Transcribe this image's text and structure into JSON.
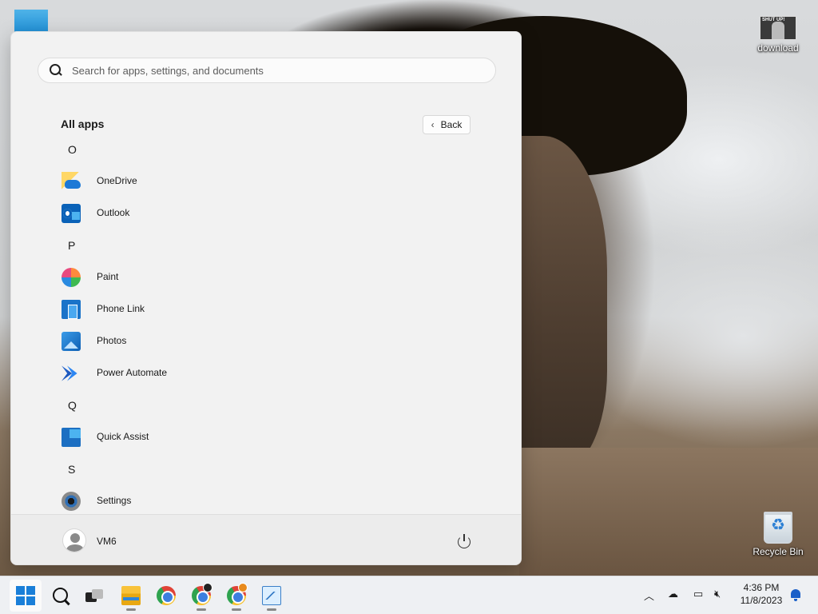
{
  "desktop": {
    "icons": [
      {
        "label": "download",
        "icon": "image-file-icon",
        "thumb_text": "SHUT UP!"
      },
      {
        "label": "Recycle Bin",
        "icon": "recycle-bin-icon"
      }
    ]
  },
  "start_menu": {
    "search": {
      "placeholder": "Search for apps, settings, and documents",
      "value": ""
    },
    "section_title": "All apps",
    "back_label": "Back",
    "apps": [
      {
        "type": "letter",
        "text": "O"
      },
      {
        "type": "app",
        "name": "OneDrive",
        "icon": "onedrive-icon"
      },
      {
        "type": "app",
        "name": "Outlook",
        "icon": "outlook-icon"
      },
      {
        "type": "letter",
        "text": "P"
      },
      {
        "type": "app",
        "name": "Paint",
        "icon": "paint-icon"
      },
      {
        "type": "app",
        "name": "Phone Link",
        "icon": "phone-link-icon"
      },
      {
        "type": "app",
        "name": "Photos",
        "icon": "photos-icon"
      },
      {
        "type": "app",
        "name": "Power Automate",
        "icon": "power-automate-icon"
      },
      {
        "type": "letter",
        "text": "Q"
      },
      {
        "type": "app",
        "name": "Quick Assist",
        "icon": "quick-assist-icon"
      },
      {
        "type": "letter",
        "text": "S"
      },
      {
        "type": "app",
        "name": "Settings",
        "icon": "settings-gear-icon"
      }
    ],
    "user": {
      "name": "VM6"
    },
    "power_icon": "power-icon"
  },
  "taskbar": {
    "items": [
      {
        "name": "start",
        "icon": "windows-logo-icon",
        "active": true
      },
      {
        "name": "search",
        "icon": "search-icon"
      },
      {
        "name": "task-view",
        "icon": "task-view-icon"
      },
      {
        "name": "file-explorer",
        "icon": "folder-icon",
        "running": true
      },
      {
        "name": "chrome",
        "icon": "chrome-icon"
      },
      {
        "name": "chrome-profile-1",
        "icon": "chrome-icon",
        "running": true
      },
      {
        "name": "chrome-profile-2",
        "icon": "chrome-icon",
        "running": true
      },
      {
        "name": "resource-monitor",
        "icon": "monitor-chart-icon",
        "running": true
      }
    ],
    "tray": {
      "icons": [
        "chevron-up-icon",
        "cloud-offline-icon",
        "network-icon",
        "volume-muted-icon"
      ],
      "time": "4:36 PM",
      "date": "11/8/2023",
      "notification_icon": "bell-icon"
    }
  },
  "colors": {
    "accent": "#1a7fd8",
    "menu_bg": "#f2f2f2",
    "taskbar_bg": "#eef0f3"
  }
}
